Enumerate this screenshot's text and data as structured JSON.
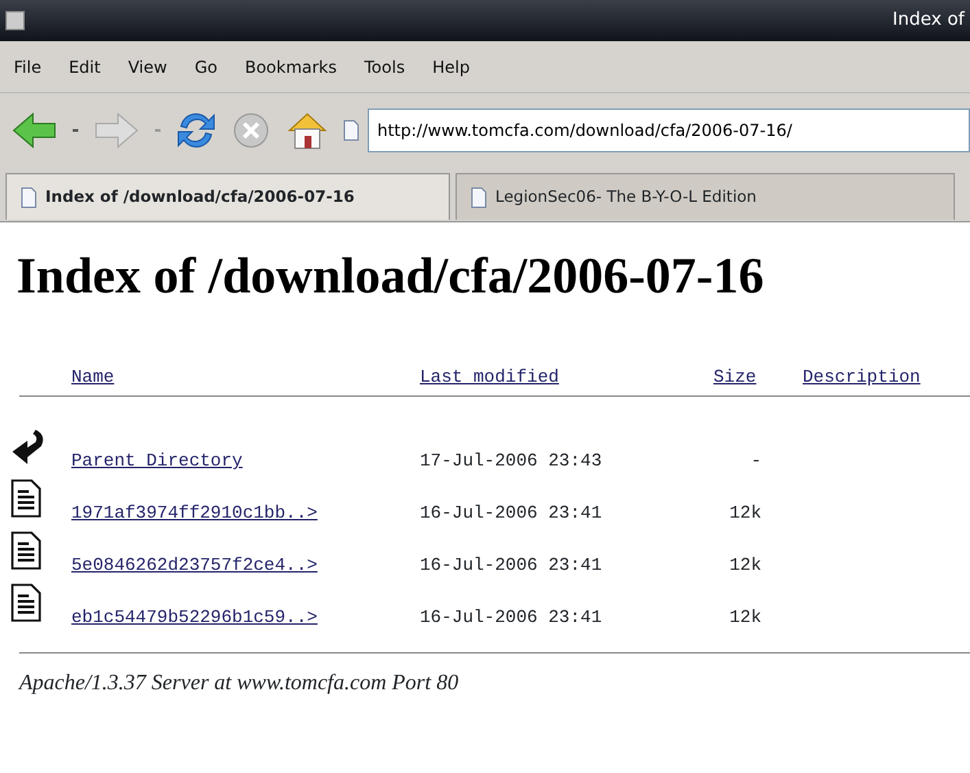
{
  "window": {
    "title": "Index of"
  },
  "menu": [
    "File",
    "Edit",
    "View",
    "Go",
    "Bookmarks",
    "Tools",
    "Help"
  ],
  "address": {
    "value": "http://www.tomcfa.com/download/cfa/2006-07-16/"
  },
  "tabs": [
    {
      "label": "Index of /download/cfa/2006-07-16",
      "selected": true
    },
    {
      "label": "LegionSec06- The B-Y-O-L Edition",
      "selected": false
    }
  ],
  "page": {
    "heading": "Index of /download/cfa/2006-07-16",
    "columns": [
      "Name",
      "Last modified",
      "Size",
      "Description"
    ],
    "rows": [
      {
        "kind": "parent",
        "name": "Parent Directory",
        "modified": "17-Jul-2006 23:43",
        "size": "-"
      },
      {
        "kind": "file",
        "name": "1971af3974ff2910c1bb..>",
        "modified": "16-Jul-2006 23:41",
        "size": "12k"
      },
      {
        "kind": "file",
        "name": "5e0846262d23757f2ce4..>",
        "modified": "16-Jul-2006 23:41",
        "size": "12k"
      },
      {
        "kind": "file",
        "name": "eb1c54479b52296b1c59..>",
        "modified": "16-Jul-2006 23:41",
        "size": "12k"
      }
    ],
    "footer": "Apache/1.3.37 Server at www.tomcfa.com Port 80"
  }
}
